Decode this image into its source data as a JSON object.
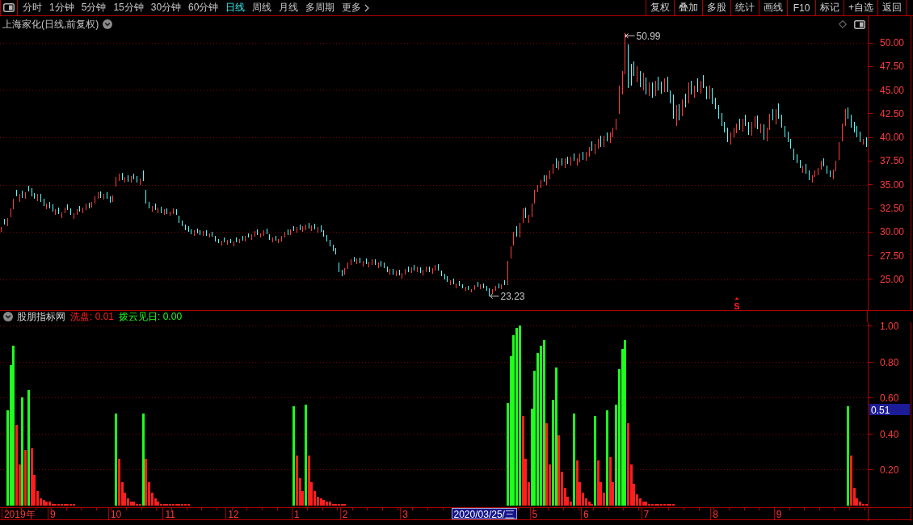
{
  "toolbar": {
    "periods": [
      {
        "label": "分时",
        "selected": false
      },
      {
        "label": "1分钟",
        "selected": false
      },
      {
        "label": "5分钟",
        "selected": false
      },
      {
        "label": "15分钟",
        "selected": false
      },
      {
        "label": "30分钟",
        "selected": false
      },
      {
        "label": "60分钟",
        "selected": false
      },
      {
        "label": "日线",
        "selected": true
      },
      {
        "label": "周线",
        "selected": false
      },
      {
        "label": "月线",
        "selected": false
      },
      {
        "label": "多周期",
        "selected": false
      }
    ],
    "more": {
      "label": "更多"
    },
    "actions": [
      "复权",
      "叠加",
      "多股",
      "统计",
      "画线",
      "F10",
      "标记",
      "+自选",
      "返回"
    ]
  },
  "chart_header": {
    "title": "上海家化(日线,前复权)"
  },
  "price_chart": {
    "axis_labels": [
      "50.00",
      "47.50",
      "45.00",
      "42.50",
      "40.00",
      "37.50",
      "35.00",
      "32.50",
      "30.00",
      "27.50",
      "25.00"
    ],
    "high_label": "50.99",
    "low_label": "23.23",
    "signal": "S"
  },
  "indicator": {
    "name": "股朋指标网",
    "readings": [
      {
        "text": ": 0.01"
      },
      {
        "text": ": 0.00"
      }
    ],
    "chart_data": {
      "type": "bar",
      "grid": true,
      "ylim": [
        -0.01,
        1.02
      ],
      "yticks": [
        {
          "value": 0.2,
          "label": "0.20"
        },
        {
          "value": 0.4,
          "label": "0.40"
        },
        {
          "value": 0.6,
          "label": "0.60"
        },
        {
          "value": 0.8,
          "label": "0.80"
        },
        {
          "value": 1.0,
          "label": "1.00"
        }
      ],
      "categories": [
        null,
        null,
        null,
        null,
        null,
        null,
        "2019年",
        null,
        null,
        null,
        null,
        null,
        null,
        null,
        null,
        null,
        null,
        "9",
        null,
        null,
        null,
        null,
        null,
        null,
        null,
        null,
        null,
        null,
        null,
        null,
        null,
        null,
        null,
        null,
        null,
        null,
        null,
        null,
        "10",
        null,
        null,
        null,
        null,
        null,
        null,
        null,
        null,
        null,
        null,
        null,
        null,
        null,
        null,
        null,
        null,
        null,
        "11",
        null,
        null,
        null,
        null,
        null,
        null,
        null,
        null,
        null,
        null,
        null,
        null,
        null,
        null,
        null,
        null,
        null,
        null,
        null,
        null,
        "12",
        null,
        null,
        null,
        null,
        null,
        null,
        null,
        null,
        null,
        null,
        null,
        null,
        null,
        null,
        null,
        null,
        null,
        null,
        null,
        null,
        "1",
        null,
        null,
        null,
        null,
        null,
        null,
        null,
        null,
        null,
        null,
        null,
        null,
        null,
        null,
        null,
        "2",
        null,
        null,
        null,
        null,
        null,
        null,
        null,
        null,
        null,
        null,
        null,
        null,
        null,
        null,
        null,
        null,
        null,
        null,
        null,
        "3",
        null,
        null,
        null,
        null,
        null,
        null,
        null,
        null,
        null,
        null,
        null,
        null,
        null,
        null,
        null,
        null,
        null,
        null,
        null,
        null,
        null,
        null,
        null,
        null,
        null,
        null,
        null,
        null,
        null,
        null,
        null,
        null,
        null,
        null,
        null,
        null,
        null,
        null,
        null,
        null,
        null,
        null,
        "5",
        null,
        null,
        null,
        null,
        null,
        null,
        null,
        null,
        null,
        null,
        null,
        null,
        null,
        null,
        null,
        null,
        "6",
        null,
        null,
        null,
        null,
        null,
        null,
        null,
        null,
        null,
        null,
        null,
        null,
        null,
        null,
        null,
        null,
        null,
        null,
        null,
        "7",
        null,
        null,
        null,
        null,
        null,
        null,
        null,
        null,
        null,
        null,
        null,
        null,
        null,
        null,
        null,
        null,
        null,
        null,
        null,
        null,
        null,
        null,
        "8",
        null,
        null,
        null,
        null,
        null,
        null,
        null,
        null,
        null,
        null,
        null,
        null,
        null,
        null,
        null,
        null,
        null,
        null,
        null,
        null,
        "9",
        null,
        null,
        null,
        null,
        null,
        null,
        null,
        null,
        null,
        null,
        null,
        null,
        null,
        null,
        null,
        null,
        null,
        null,
        null,
        null,
        null,
        null,
        null,
        null,
        null,
        null,
        null,
        null,
        null
      ],
      "series": [
        {
          "name": "洗盘",
          "color": "#ff1e1e",
          "values": [
            0,
            0,
            0,
            0,
            0,
            0.45,
            0.23,
            0,
            0.31,
            0,
            0.32,
            0.17,
            0.08,
            0.04,
            0.03,
            0.02,
            0.02,
            0.01,
            0.01,
            0.01,
            0.01,
            0.01,
            0.01,
            0.01,
            0.01,
            0,
            0,
            0,
            0,
            0,
            0,
            0,
            0,
            0,
            0,
            0,
            0,
            0,
            0,
            0.26,
            0.13,
            0.07,
            0.04,
            0.02,
            0.02,
            0.01,
            0.01,
            0,
            0.26,
            0.13,
            0.07,
            0.04,
            0.02,
            0.01,
            0.01,
            0.01,
            0.01,
            0.01,
            0.01,
            0.01,
            0.01,
            0.01,
            0.01,
            0,
            0,
            0,
            0,
            0,
            0,
            0,
            0,
            0,
            0,
            0,
            0,
            0,
            0,
            0,
            0,
            0,
            0,
            0,
            0,
            0,
            0,
            0,
            0,
            0,
            0,
            0,
            0,
            0,
            0,
            0,
            0,
            0,
            0,
            0,
            0.28,
            0.15,
            0.08,
            0,
            0.28,
            0.13,
            0.08,
            0.05,
            0.04,
            0.03,
            0.02,
            0.02,
            0.01,
            0.01,
            0.01,
            0.01,
            0.01,
            0,
            0,
            0,
            0,
            0,
            0,
            0,
            0,
            0,
            0,
            0,
            0,
            0,
            0,
            0,
            0,
            0,
            0,
            0,
            0,
            0,
            0,
            0,
            0,
            0,
            0,
            0,
            0,
            0,
            0,
            0,
            0,
            0,
            0,
            0,
            0,
            0,
            0,
            0,
            0,
            0,
            0,
            0,
            0,
            0,
            0,
            0,
            0,
            0,
            0,
            0,
            0,
            0,
            0,
            0,
            0,
            0,
            0,
            0.5,
            0.26,
            0.13,
            0,
            0,
            0,
            0,
            0,
            0.46,
            0.23,
            0,
            0,
            0.39,
            0.19,
            0.1,
            0.05,
            0.02,
            0,
            0.25,
            0.13,
            0.07,
            0.04,
            0.02,
            0.01,
            0,
            0.25,
            0.13,
            0.07,
            0,
            0.27,
            0.13,
            0,
            0,
            0,
            0,
            0.46,
            0.23,
            0.12,
            0.06,
            0.04,
            0.02,
            0.02,
            0.01,
            0.01,
            0.01,
            0.01,
            0.01,
            0.01,
            0.01,
            0.01,
            0.01,
            0,
            0,
            0,
            0,
            0,
            0,
            0,
            0,
            0,
            0,
            0,
            0,
            0,
            0,
            0,
            0,
            0,
            0,
            0,
            0,
            0,
            0,
            0,
            0,
            0,
            0,
            0,
            0,
            0,
            0,
            0,
            0,
            0,
            0,
            0,
            0,
            0,
            0,
            0,
            0,
            0,
            0,
            0,
            0,
            0,
            0,
            0,
            0,
            0,
            0,
            0,
            0,
            0,
            0,
            0,
            0,
            0,
            0,
            0.28,
            0.1,
            0.04,
            0.02,
            0.01,
            0.01
          ]
        },
        {
          "name": "拨云见日",
          "color": "#1eff1e",
          "values": [
            0,
            0,
            0.53,
            0.78,
            0.89,
            0,
            0,
            0.6,
            0,
            0.64,
            0,
            0,
            0,
            0,
            0,
            0,
            0,
            0,
            0,
            0,
            0,
            0,
            0,
            0,
            0,
            0,
            0,
            0,
            0,
            0,
            0,
            0,
            0,
            0,
            0,
            0,
            0,
            0,
            0.51,
            0,
            0,
            0,
            0,
            0,
            0,
            0,
            0,
            0.51,
            0,
            0,
            0,
            0,
            0,
            0,
            0,
            0,
            0,
            0,
            0,
            0,
            0,
            0,
            0,
            0,
            0,
            0,
            0,
            0,
            0,
            0,
            0,
            0,
            0,
            0,
            0,
            0,
            0,
            0,
            0,
            0,
            0,
            0,
            0,
            0,
            0,
            0,
            0,
            0,
            0,
            0,
            0,
            0,
            0,
            0,
            0,
            0,
            0,
            0.55,
            0,
            0,
            0,
            0.56,
            0,
            0,
            0,
            0,
            0,
            0,
            0,
            0,
            0,
            0,
            0,
            0,
            0,
            0,
            0,
            0,
            0,
            0,
            0,
            0,
            0,
            0,
            0,
            0,
            0,
            0,
            0,
            0,
            0,
            0,
            0,
            0,
            0,
            0,
            0,
            0,
            0,
            0,
            0,
            0,
            0,
            0,
            0,
            0,
            0,
            0,
            0,
            0,
            0,
            0,
            0,
            0,
            0,
            0,
            0,
            0,
            0,
            0,
            0,
            0,
            0,
            0,
            0,
            0,
            0,
            0,
            0.57,
            0.83,
            0.95,
            0.99,
            1.0,
            0,
            0,
            0,
            0.54,
            0.75,
            0.85,
            0.89,
            0.92,
            0,
            0,
            0.59,
            0.77,
            0,
            0,
            0,
            0,
            0,
            0.51,
            0,
            0,
            0,
            0,
            0,
            0,
            0.5,
            0,
            0,
            0,
            0.53,
            0,
            0,
            0.56,
            0.76,
            0.87,
            0.92,
            0,
            0,
            0,
            0,
            0,
            0,
            0,
            0,
            0,
            0,
            0,
            0,
            0,
            0,
            0,
            0,
            0,
            0,
            0,
            0,
            0,
            0,
            0,
            0,
            0,
            0,
            0,
            0,
            0,
            0,
            0,
            0,
            0,
            0,
            0,
            0,
            0,
            0,
            0,
            0,
            0,
            0,
            0,
            0,
            0,
            0,
            0,
            0,
            0,
            0,
            0,
            0,
            0,
            0,
            0,
            0,
            0,
            0,
            0,
            0,
            0,
            0,
            0,
            0,
            0,
            0,
            0,
            0,
            0,
            0,
            0,
            0,
            0,
            0.55,
            0,
            0,
            0,
            0,
            0,
            0
          ]
        }
      ]
    },
    "value_tag": {
      "text": "0.51"
    },
    "cursor_date": {
      "text": "2020/03/25/三"
    }
  }
}
